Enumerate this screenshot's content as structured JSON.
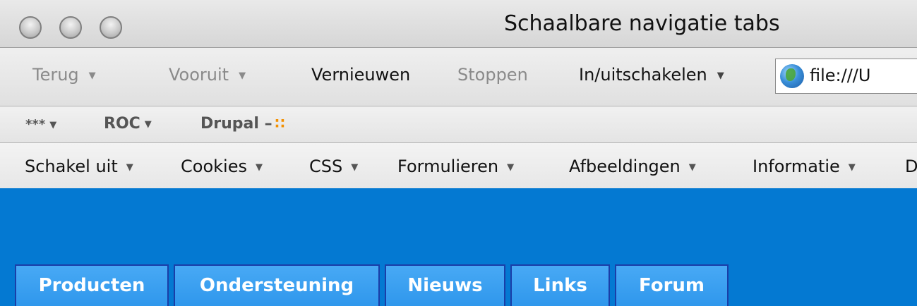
{
  "window": {
    "title": "Schaalbare navigatie tabs"
  },
  "nav": {
    "back": "Terug",
    "forward": "Vooruit",
    "reload": "Vernieuwen",
    "stop": "Stoppen",
    "toggle": "In/uitschakelen",
    "url": "file:///U",
    "arrow_glyph": "▼"
  },
  "bookmarks": {
    "items": [
      {
        "label": "***"
      },
      {
        "label": "ROC"
      },
      {
        "label": "Drupal –"
      }
    ]
  },
  "devtoolbar": {
    "items": [
      {
        "label": "Schakel uit"
      },
      {
        "label": "Cookies"
      },
      {
        "label": "CSS"
      },
      {
        "label": "Formulieren"
      },
      {
        "label": "Afbeeldingen"
      },
      {
        "label": "Informatie"
      },
      {
        "label": "D"
      }
    ]
  },
  "page": {
    "background": "#0479d2",
    "tab_color": "#3ea0f0",
    "tab_border": "#1a3ea8",
    "tabs": [
      {
        "label": "Producten"
      },
      {
        "label": "Ondersteuning"
      },
      {
        "label": "Nieuws"
      },
      {
        "label": "Links"
      },
      {
        "label": "Forum"
      }
    ]
  }
}
